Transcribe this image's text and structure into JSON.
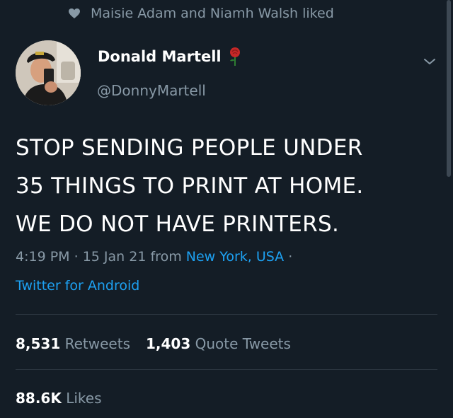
{
  "social_context": {
    "text": "Maisie Adam and Niamh Walsh liked",
    "icon": "heart-icon"
  },
  "author": {
    "name": "Donald Martell",
    "handle": "@DonnyMartell",
    "emoji": "rose"
  },
  "tweet": {
    "lines": [
      "STOP SENDING PEOPLE UNDER",
      "35 THINGS TO PRINT AT HOME.",
      "WE DO NOT HAVE PRINTERS."
    ]
  },
  "meta": {
    "time": "4:19 PM",
    "date": "15 Jan 21",
    "from_label": "from",
    "location": "New York, USA",
    "separator": "·",
    "source": "Twitter for Android"
  },
  "stats": {
    "retweets": {
      "count": "8,531",
      "label": "Retweets"
    },
    "quotes": {
      "count": "1,403",
      "label": "Quote Tweets"
    },
    "likes": {
      "count": "88.6K",
      "label": "Likes"
    }
  },
  "colors": {
    "background": "#141d26",
    "secondary": "#8899a6",
    "link": "#1da1f2"
  }
}
